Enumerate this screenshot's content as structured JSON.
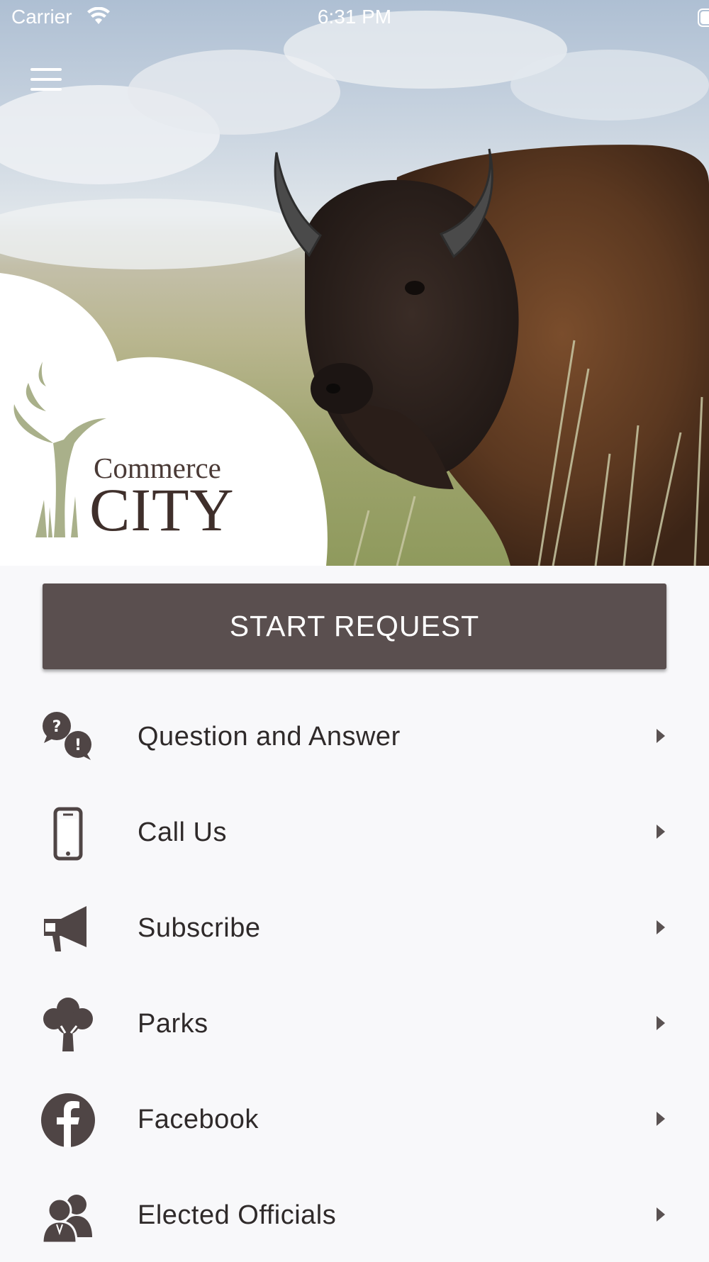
{
  "status_bar": {
    "carrier": "Carrier",
    "time": "6:31 PM"
  },
  "header": {
    "menu_icon": "hamburger-menu-icon",
    "logo": {
      "line1": "Commerce",
      "line2": "CITY"
    }
  },
  "start_request": {
    "label": "START REQUEST"
  },
  "menu": {
    "items": [
      {
        "label": "Question and Answer",
        "icon": "question-answer-icon"
      },
      {
        "label": "Call Us",
        "icon": "phone-icon"
      },
      {
        "label": "Subscribe",
        "icon": "megaphone-icon"
      },
      {
        "label": "Parks",
        "icon": "tree-icon"
      },
      {
        "label": "Facebook",
        "icon": "facebook-icon"
      },
      {
        "label": "Elected Officials",
        "icon": "officials-icon"
      }
    ]
  },
  "colors": {
    "primary_button": "#5a4f4f",
    "icon": "#4f4545",
    "text": "#2f2a2a",
    "background": "#f8f8fa"
  }
}
